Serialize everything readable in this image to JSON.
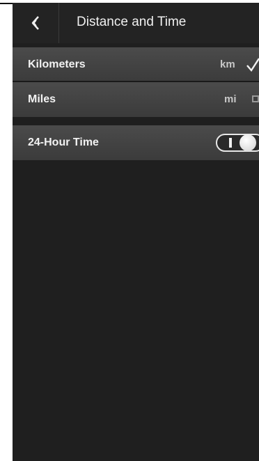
{
  "header": {
    "title": "Distance and Time",
    "back_icon": "chevron-left-icon"
  },
  "distance": {
    "options": [
      {
        "label": "Kilometers",
        "unit": "km",
        "selected": true
      },
      {
        "label": "Miles",
        "unit": "mi",
        "selected": false
      }
    ]
  },
  "time": {
    "label": "24-Hour Time",
    "enabled": true
  },
  "colors": {
    "background": "#1f1f1f",
    "row": "#444444",
    "text": "#f2f2f2"
  }
}
